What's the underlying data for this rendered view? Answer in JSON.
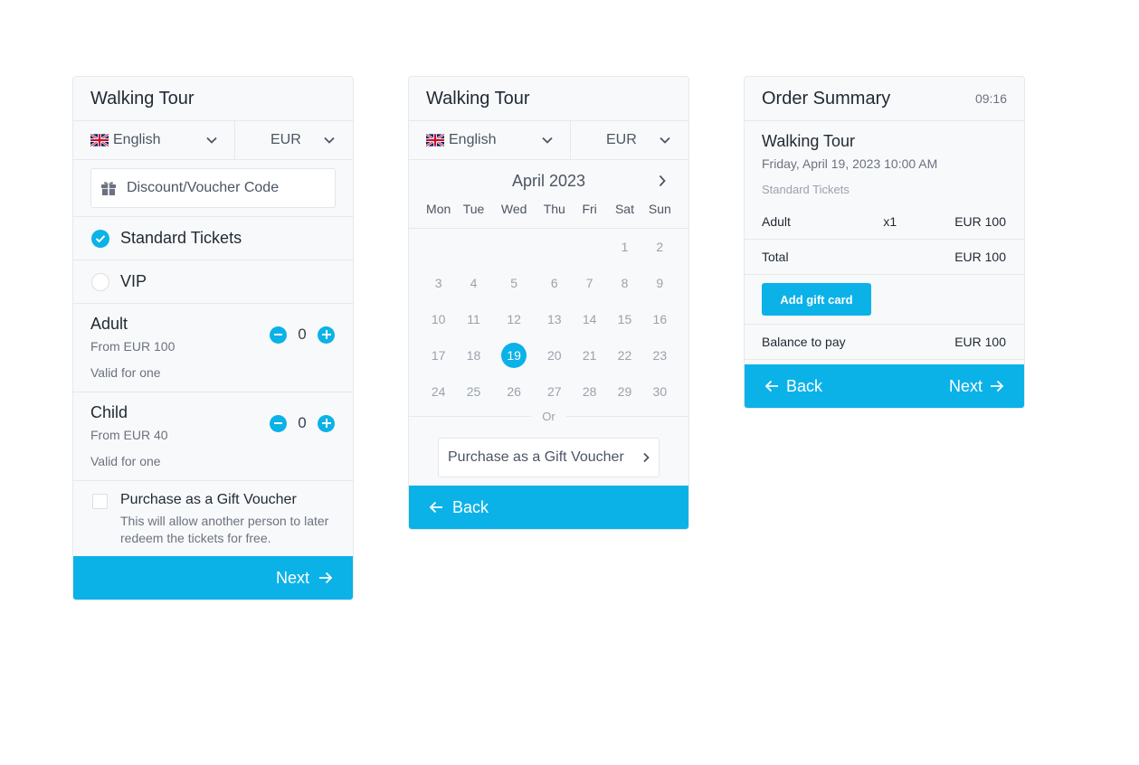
{
  "colors": {
    "accent": "#0bb2e8",
    "border": "#e6e8eb",
    "panel": "#f8f9fa"
  },
  "tickets_panel": {
    "title": "Walking Tour",
    "language": "English",
    "currency": "EUR",
    "voucher_placeholder": "Discount/Voucher Code",
    "ticket_types": [
      {
        "label": "Standard Tickets",
        "selected": true
      },
      {
        "label": "VIP",
        "selected": false
      }
    ],
    "tickets": [
      {
        "name": "Adult",
        "price": "From EUR 100",
        "valid": "Valid for one",
        "quantity": "0"
      },
      {
        "name": "Child",
        "price": "From EUR 40",
        "valid": "Valid for one",
        "quantity": "0"
      }
    ],
    "gift_voucher": {
      "title": "Purchase as a Gift Voucher",
      "description": "This will allow another person to later redeem the tickets for free.",
      "checked": false
    },
    "next_label": "Next"
  },
  "calendar_panel": {
    "title": "Walking Tour",
    "language": "English",
    "currency": "EUR",
    "month_label": "April 2023",
    "weekdays": [
      "Mon",
      "Tue",
      "Wed",
      "Thu",
      "Fri",
      "Sat",
      "Sun"
    ],
    "weeks": [
      [
        "",
        "",
        "",
        "",
        "",
        "1",
        "2"
      ],
      [
        "3",
        "4",
        "5",
        "6",
        "7",
        "8",
        "9"
      ],
      [
        "10",
        "11",
        "12",
        "13",
        "14",
        "15",
        "16"
      ],
      [
        "17",
        "18",
        "19",
        "20",
        "21",
        "22",
        "23"
      ],
      [
        "24",
        "25",
        "26",
        "27",
        "28",
        "29",
        "30"
      ]
    ],
    "selected_day": "19",
    "or_label": "Or",
    "gift_voucher_label": "Purchase as a Gift Voucher",
    "back_label": "Back"
  },
  "summary_panel": {
    "title": "Order Summary",
    "timer": "09:16",
    "tour_name": "Walking Tour",
    "date_time": "Friday, April 19, 2023 10:00 AM",
    "ticket_category": "Standard Tickets",
    "line_item": {
      "name": "Adult",
      "qty": "x1",
      "amount": "EUR 100"
    },
    "total": {
      "label": "Total",
      "amount": "EUR 100"
    },
    "add_gift_card_label": "Add gift card",
    "balance": {
      "label": "Balance to pay",
      "amount": "EUR 100"
    },
    "back_label": "Back",
    "next_label": "Next"
  }
}
